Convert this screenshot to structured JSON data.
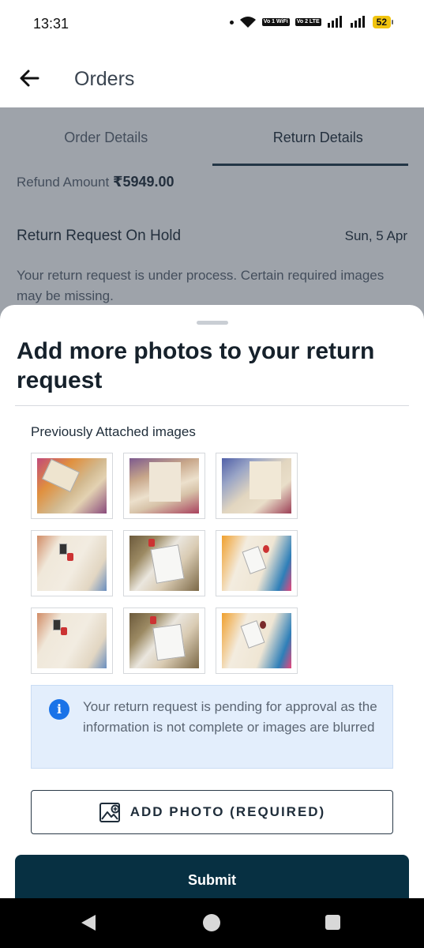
{
  "status_bar": {
    "time": "13:31",
    "signal_tags": [
      "Vo 1 WiFi",
      "Vo 2 LTE"
    ],
    "battery": "52"
  },
  "app_bar": {
    "back_icon": "arrow-left-icon",
    "title": "Orders"
  },
  "tabs": [
    {
      "label": "Order Details",
      "active": false
    },
    {
      "label": "Return Details",
      "active": true
    }
  ],
  "refund": {
    "label": "Refund Amount",
    "amount": "₹5949.00"
  },
  "return_status": {
    "title": "Return Request On Hold",
    "date": "Sun, 5 Apr",
    "description": "Your return request is under process. Certain required images may be missing."
  },
  "sheet": {
    "title": "Add more photos to your return request",
    "previously_attached_label": "Previously Attached images",
    "images": [
      {
        "name": "attached-image-1",
        "style": "pink"
      },
      {
        "name": "attached-image-2",
        "style": "pink2"
      },
      {
        "name": "attached-image-3",
        "style": "blue"
      },
      {
        "name": "attached-image-4",
        "style": "cream"
      },
      {
        "name": "attached-image-5",
        "style": "tag"
      },
      {
        "name": "attached-image-6",
        "style": "orange"
      },
      {
        "name": "attached-image-7",
        "style": "cream"
      },
      {
        "name": "attached-image-8",
        "style": "tag"
      },
      {
        "name": "attached-image-9",
        "style": "orange"
      }
    ],
    "info_icon": "info-icon",
    "info_text": "Your return request is pending for approval as the information is not complete or images are blurred",
    "add_photo_label": "ADD PHOTO (REQUIRED)",
    "add_photo_icon": "add-image-icon",
    "submit_label": "Submit"
  },
  "nav_bar": {
    "icons": [
      "nav-back-icon",
      "nav-home-icon",
      "nav-recents-icon"
    ]
  },
  "colors": {
    "primary_dark": "#073042",
    "info_blue": "#1a73e8",
    "info_bg": "#e3eefc",
    "battery": "#f1c40f"
  }
}
